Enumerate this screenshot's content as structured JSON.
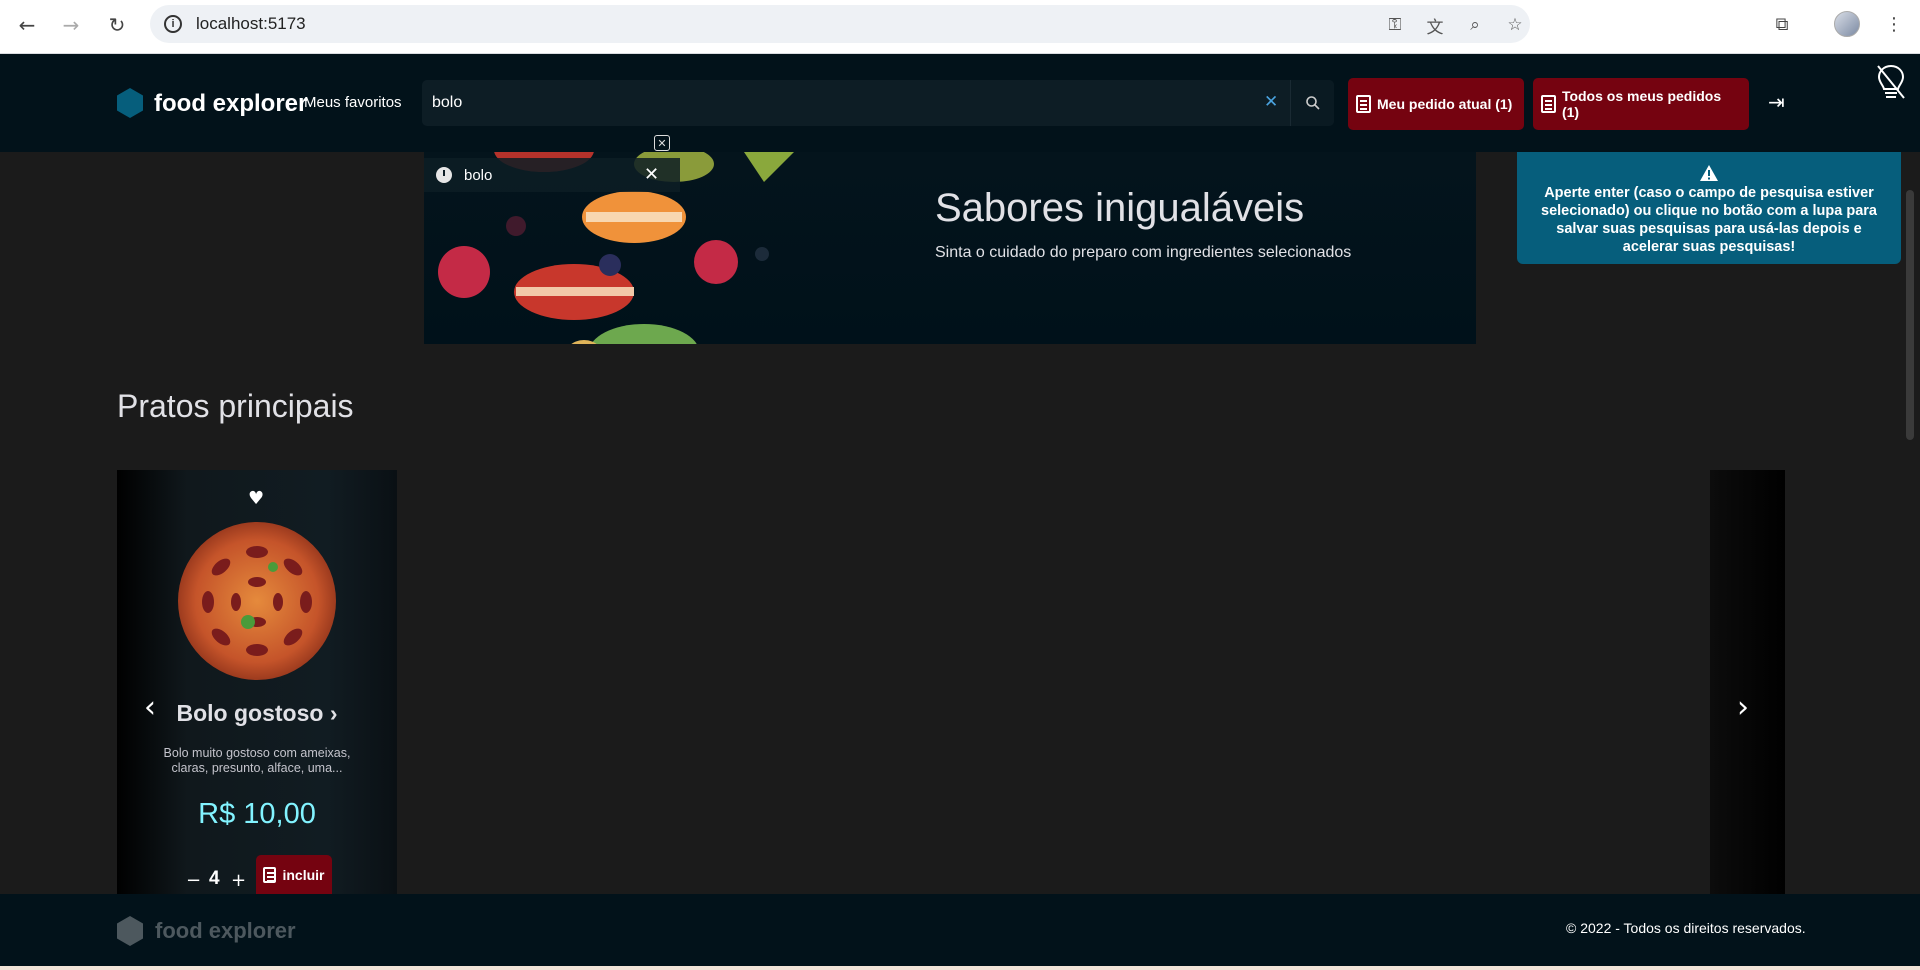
{
  "browser": {
    "url": "localhost:5173",
    "icons": [
      "back-icon",
      "forward-icon",
      "reload-icon",
      "info-icon",
      "password-key-icon",
      "translate-icon",
      "zoom-icon",
      "bookmark-star-icon",
      "extensions-icon",
      "profile-avatar",
      "menu-dots-icon"
    ]
  },
  "header": {
    "logo_text": "food explorer",
    "favorites_link": "Meus favoritos",
    "search": {
      "value": "bolo",
      "placeholder": ""
    },
    "current_order_label": "Meu pedido atual (1)",
    "all_orders_label": "Todos os meus pedidos (1)"
  },
  "search_suggestions": {
    "items": [
      {
        "text": "bolo"
      }
    ]
  },
  "banner": {
    "title": "Sabores inigualáveis",
    "subtitle": "Sinta o cuidado do preparo com ingredientes selecionados"
  },
  "tooltip": {
    "text": "Aperte enter (caso o campo de pesquisa estiver selecionado) ou clique no botão com a lupa para salvar suas pesquisas para usá-las depois e acelerar suas pesquisas!"
  },
  "section": {
    "title": "Pratos principais"
  },
  "dish": {
    "name": "Bolo gostoso",
    "name_arrow": "›",
    "description": "Bolo muito gostoso com ameixas, claras, presunto, alface, uma...",
    "price": "R$ 10,00",
    "quantity": "4",
    "include_label": "incluir"
  },
  "footer": {
    "logo_text": "food explorer",
    "copyright": "© 2022 - Todos os direitos reservados."
  },
  "colors": {
    "header_bg": "#02121a",
    "accent_red": "#750310",
    "tooltip_bg": "#065e7c",
    "price_cyan": "#82f3ff"
  }
}
